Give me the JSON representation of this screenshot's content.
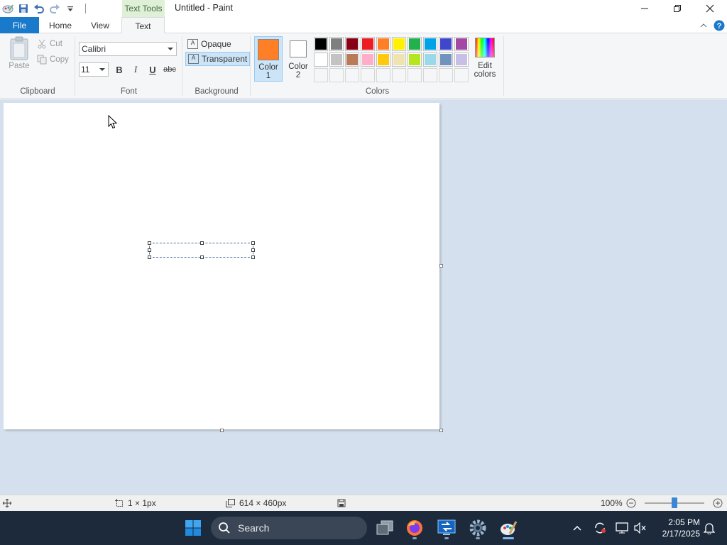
{
  "window": {
    "title": "Untitled - Paint",
    "context_tab": "Text Tools"
  },
  "tabs": {
    "file": "File",
    "home": "Home",
    "view": "View",
    "text": "Text"
  },
  "ribbon": {
    "clipboard": {
      "label": "Clipboard",
      "paste": "Paste",
      "cut": "Cut",
      "copy": "Copy"
    },
    "font": {
      "label": "Font",
      "family": "Calibri",
      "size": "11",
      "bold": "B",
      "italic": "I",
      "underline": "U",
      "strike": "abc"
    },
    "background": {
      "label": "Background",
      "opaque": "Opaque",
      "transparent": "Transparent",
      "selected": "transparent"
    },
    "colors": {
      "label": "Colors",
      "color1_line1": "Color",
      "color1_line2": "1",
      "color2_line1": "Color",
      "color2_line2": "2",
      "color1": "#ff7f27",
      "color2": "#ffffff",
      "edit_line1": "Edit",
      "edit_line2": "colors",
      "palette_row1": [
        "#000000",
        "#7f7f7f",
        "#880015",
        "#ed1c24",
        "#ff7f27",
        "#fff200",
        "#22b14c",
        "#00a2e8",
        "#3f48cc",
        "#a349a4"
      ],
      "palette_row2": [
        "#ffffff",
        "#c3c3c3",
        "#b97a57",
        "#ffaec9",
        "#ffc90e",
        "#efe4b0",
        "#b5e61d",
        "#99d9ea",
        "#7092be",
        "#c8bfe7"
      ]
    }
  },
  "status": {
    "selection_size": "1 × 1px",
    "canvas_size": "614 × 460px",
    "zoom": "100%"
  },
  "taskbar": {
    "search": "Search",
    "time": "2:05 PM",
    "date": "2/17/2025"
  },
  "accent": "#1979ca"
}
